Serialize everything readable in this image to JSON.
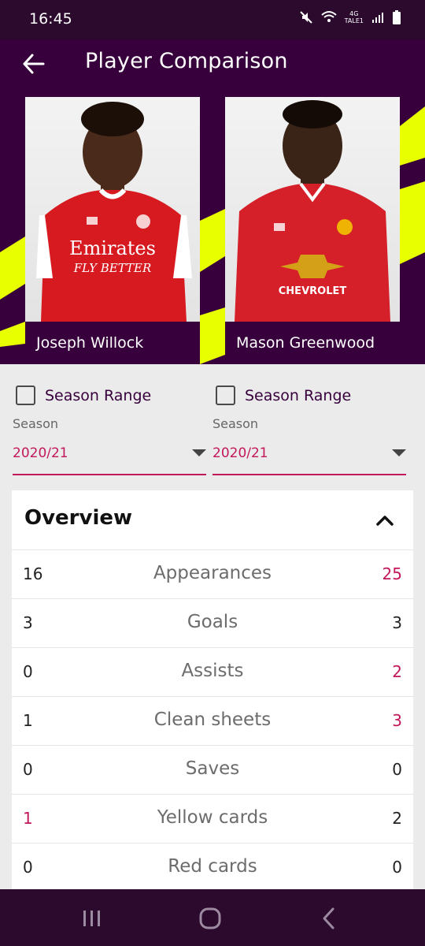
{
  "status_bar": {
    "time": "16:45",
    "network": "4G",
    "carrier": "TALE1"
  },
  "app_bar": {
    "title": "Player Comparison"
  },
  "players": [
    {
      "name": "Joseph Willock",
      "shirt_sponsor": "Emirates",
      "shirt_sponsor_sub": "FLY BETTER",
      "kit_color": "#d71920"
    },
    {
      "name": "Mason Greenwood",
      "shirt_sponsor": "CHEVROLET",
      "kit_color": "#d5202a"
    }
  ],
  "filters": [
    {
      "checkbox_label": "Season Range",
      "season_label": "Season",
      "season_value": "2020/21"
    },
    {
      "checkbox_label": "Season Range",
      "season_label": "Season",
      "season_value": "2020/21"
    }
  ],
  "overview": {
    "title": "Overview",
    "stats": [
      {
        "label": "Appearances",
        "left": "16",
        "right": "25",
        "highlight": "right"
      },
      {
        "label": "Goals",
        "left": "3",
        "right": "3",
        "highlight": "none"
      },
      {
        "label": "Assists",
        "left": "0",
        "right": "2",
        "highlight": "right"
      },
      {
        "label": "Clean sheets",
        "left": "1",
        "right": "3",
        "highlight": "right"
      },
      {
        "label": "Saves",
        "left": "0",
        "right": "0",
        "highlight": "none"
      },
      {
        "label": "Yellow cards",
        "left": "1",
        "right": "2",
        "highlight": "left"
      },
      {
        "label": "Red cards",
        "left": "0",
        "right": "0",
        "highlight": "none"
      }
    ]
  },
  "colors": {
    "primary": "#37003c",
    "accent": "#c2185b",
    "neon": "#e8ff00"
  },
  "icons": [
    "back-arrow-icon",
    "chevron-up-icon",
    "recent-apps-icon",
    "home-icon",
    "back-icon",
    "mute-icon",
    "wifi-icon",
    "signal-icon",
    "battery-icon"
  ]
}
